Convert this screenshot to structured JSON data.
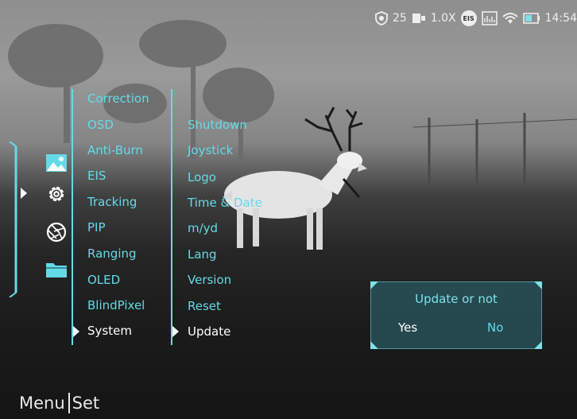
{
  "status_bar": {
    "shield_value": "25",
    "zoom": "1.0X",
    "eis_badge": "EIS",
    "time": "14:54"
  },
  "tabs": [
    {
      "icon": "image-icon"
    },
    {
      "icon": "gear-icon",
      "selected": true
    },
    {
      "icon": "aperture-icon"
    },
    {
      "icon": "folder-icon"
    }
  ],
  "menu": {
    "items": [
      "Correction",
      "OSD",
      "Anti-Burn",
      "EIS",
      "Tracking",
      "PIP",
      "Ranging",
      "OLED",
      "BlindPixel",
      "System"
    ],
    "selected_index": 9
  },
  "submenu": {
    "items": [
      "Shutdown",
      "Joystick",
      "Logo",
      "Time & Date",
      "m/yd",
      "Lang",
      "Version",
      "Reset",
      "Update"
    ],
    "selected_index": 8
  },
  "dialog": {
    "title": "Update or not",
    "yes": "Yes",
    "no": "No"
  },
  "footer": {
    "menu": "Menu",
    "set": "Set"
  },
  "colors": {
    "accent": "#63dbe7",
    "dialog_bg": "#285a62",
    "selected_text": "#ffffff"
  }
}
